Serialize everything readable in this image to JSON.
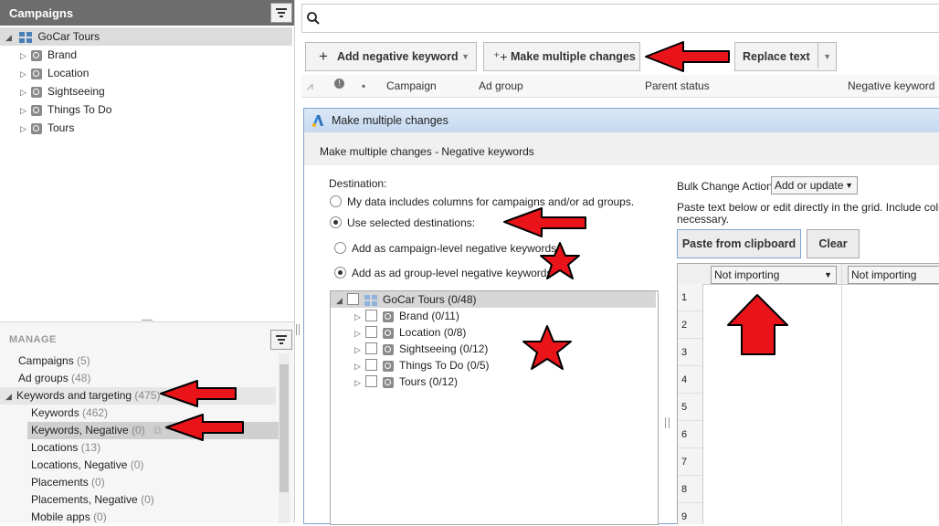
{
  "left": {
    "title": "Campaigns",
    "tree": {
      "root": "GoCar Tours",
      "children": [
        "Brand",
        "Location",
        "Sightseeing",
        "Things To Do",
        "Tours"
      ]
    },
    "manage": {
      "heading": "MANAGE",
      "items": [
        {
          "label": "Campaigns",
          "count": "(5)"
        },
        {
          "label": "Ad groups",
          "count": "(48)"
        },
        {
          "label": "Keywords and targeting",
          "count": "(475)"
        },
        {
          "label": "Keywords",
          "count": "(462)"
        },
        {
          "label": "Keywords, Negative",
          "count": "(0)"
        },
        {
          "label": "Locations",
          "count": "(13)"
        },
        {
          "label": "Locations, Negative",
          "count": "(0)"
        },
        {
          "label": "Placements",
          "count": "(0)"
        },
        {
          "label": "Placements, Negative",
          "count": "(0)"
        },
        {
          "label": "Mobile apps",
          "count": "(0)"
        }
      ]
    }
  },
  "toolbar": {
    "add_negative_keyword": "Add negative keyword",
    "make_multiple_changes": "Make multiple changes",
    "replace_text": "Replace text"
  },
  "grid_header": {
    "columns": [
      "Campaign",
      "Ad group",
      "Parent status",
      "Negative keyword"
    ]
  },
  "dialog": {
    "title": "Make multiple changes",
    "subtitle": "Make multiple changes - Negative keywords",
    "destination_label": "Destination:",
    "opt_columns": "My data includes columns for campaigns and/or ad groups.",
    "opt_selected": "Use selected destinations:",
    "opt_campaign_level": "Add as campaign-level negative keywords",
    "opt_adgroup_level": "Add as ad group-level negative keywords",
    "dest_tree": {
      "root": "GoCar Tours (0/48)",
      "children": [
        "Brand (0/11)",
        "Location (0/8)",
        "Sightseeing (0/12)",
        "Things To Do (0/5)",
        "Tours (0/12)"
      ]
    },
    "bulk_label": "Bulk Change Action:",
    "bulk_value": "Add or update",
    "paste_hint_1": "Paste text below or edit directly in the grid. Include column h",
    "paste_hint_2": "necessary.",
    "paste_button": "Paste from clipboard",
    "clear_button": "Clear",
    "col_select_1": "Not importing",
    "col_select_2": "Not importing",
    "row_numbers": [
      "1",
      "2",
      "3",
      "4",
      "5",
      "6",
      "7",
      "8",
      "9"
    ]
  },
  "colors": {
    "annotation_red": "#e8141a",
    "title_bar": "#6d6d6d",
    "selection": "#dcdcdc"
  }
}
